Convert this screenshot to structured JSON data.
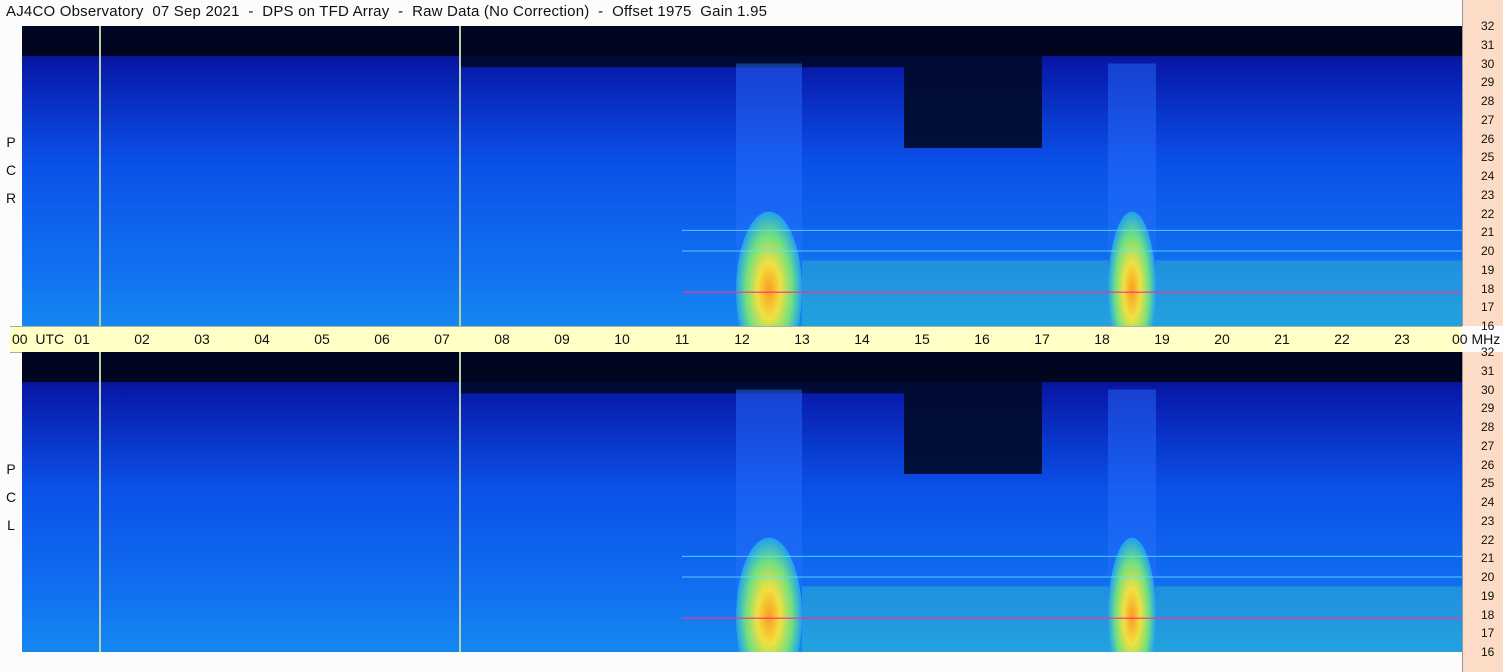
{
  "title": "AJ4CO Observatory  07 Sep 2021  -  DPS on TFD Array  -  Raw Data (No Correction)  -  Offset 1975  Gain 1.95",
  "colors": {
    "background": "#000820",
    "axis_bg": "#fcdcc6",
    "time_bar_bg": "#ffffc6",
    "gap_line": "#b8d0a8"
  },
  "time_axis": {
    "labels": [
      "00",
      "01",
      "02",
      "03",
      "04",
      "05",
      "06",
      "07",
      "08",
      "09",
      "10",
      "11",
      "12",
      "13",
      "14",
      "15",
      "16",
      "17",
      "18",
      "19",
      "20",
      "21",
      "22",
      "23",
      "00"
    ],
    "utc_label": "UTC",
    "end_unit": "MHz"
  },
  "panels": [
    {
      "id": "rcp",
      "label": [
        "R",
        "C",
        "P"
      ]
    },
    {
      "id": "lcp",
      "label": [
        "L",
        "C",
        "P"
      ]
    }
  ],
  "chart_data": {
    "type": "heatmap",
    "title": "AJ4CO Observatory  07 Sep 2021  -  DPS on TFD Array  -  Raw Data (No Correction)  -  Offset 1975  Gain 1.95",
    "xlabel": "UTC",
    "ylabel": "MHz",
    "x_ticks": [
      "00",
      "01",
      "02",
      "03",
      "04",
      "05",
      "06",
      "07",
      "08",
      "09",
      "10",
      "11",
      "12",
      "13",
      "14",
      "15",
      "16",
      "17",
      "18",
      "19",
      "20",
      "21",
      "22",
      "23",
      "00"
    ],
    "xlim_hours": [
      0,
      24
    ],
    "y_ticks": [
      16,
      17,
      18,
      19,
      20,
      21,
      22,
      23,
      24,
      25,
      26,
      27,
      28,
      29,
      30,
      31,
      32
    ],
    "ylim_mhz": [
      16,
      32
    ],
    "series": [
      {
        "name": "R C P"
      },
      {
        "name": "L C P"
      }
    ],
    "data_gaps_utc_hours": [
      1.3,
      7.3
    ],
    "bright_bursts_utc_hours": [
      [
        11.9,
        13.0
      ],
      [
        18.1,
        18.9
      ]
    ],
    "interference_lines_mhz": [
      17.8,
      20.0,
      21.1
    ],
    "colormap": "jet"
  }
}
